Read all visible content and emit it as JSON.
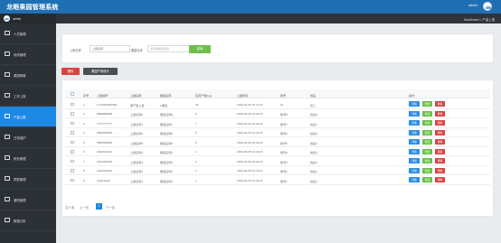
{
  "app": {
    "title": "龙眼果园管理系统",
    "user": "admin",
    "breadcrumb": "Dashboard > 产量上报"
  },
  "sidebar": {
    "profile_name": "admin",
    "items": [
      {
        "label": "人员管理",
        "icon": "users-icon",
        "active": false
      },
      {
        "label": "地块管理",
        "icon": "grid-icon",
        "active": false
      },
      {
        "label": "果园种植",
        "icon": "tree-icon",
        "active": false
      },
      {
        "label": "工作上报",
        "icon": "report-icon",
        "active": false
      },
      {
        "label": "产量上报",
        "icon": "list-icon",
        "active": true
      },
      {
        "label": "日常维护",
        "icon": "checklist-icon",
        "active": false
      },
      {
        "label": "财务管理",
        "icon": "chart-icon",
        "active": false
      },
      {
        "label": "预算管理",
        "icon": "user-icon",
        "active": false
      },
      {
        "label": "通知管理",
        "icon": "document-icon",
        "active": false
      },
      {
        "label": "数据分析",
        "icon": "analytics-icon",
        "active": false
      }
    ]
  },
  "search": {
    "label1": "上报名称",
    "input1_placeholder": "上报名称",
    "label2": "果园名称",
    "select2_placeholder": "请选择果园名称",
    "button": "查询"
  },
  "actions": {
    "delete": "删除",
    "stats": "果园产量统计"
  },
  "table": {
    "columns": [
      "序号",
      "上报编号",
      "上报名称",
      "果园名称",
      "实际产量(kg)",
      "上报时间",
      "账号",
      "姓名",
      "操作"
    ],
    "rows": [
      [
        "1",
        "1712381860959",
        "果产量上报",
        "A果园",
        "40",
        "2024-04-05 15:11:22",
        "11",
        "张三"
      ],
      [
        "2",
        "8888888888",
        "上报名称8",
        "果园名称8",
        "8",
        "2024-04-05 14:44:21",
        "账号8",
        "姓名8"
      ],
      [
        "3",
        "7777777777",
        "上报名称7",
        "果园名称7",
        "7",
        "2024-04-05 14:44:21",
        "账号7",
        "姓名7"
      ],
      [
        "4",
        "6666666666",
        "上报名称6",
        "果园名称6",
        "6",
        "2024-04-05 14:44:21",
        "账号6",
        "姓名6"
      ],
      [
        "5",
        "5555555555",
        "上报名称5",
        "果园名称5",
        "5",
        "2024-04-05 14:44:21",
        "账号5",
        "姓名5"
      ],
      [
        "6",
        "4444444444",
        "上报名称4",
        "果园名称4",
        "4",
        "2024-04-05 14:44:21",
        "账号4",
        "姓名4"
      ],
      [
        "7",
        "3333333333",
        "上报名称3",
        "果园名称3",
        "3",
        "2024-04-05 14:44:21",
        "账号3",
        "姓名3"
      ],
      [
        "8",
        "2222222222",
        "上报名称2",
        "果园名称2",
        "2",
        "2024-04-05 14:44:21",
        "账号2",
        "姓名2"
      ],
      [
        "9",
        "1111111111",
        "上报名称1",
        "果园名称1",
        "1",
        "2024-04-05 14:44:21",
        "账号1",
        "姓名1"
      ]
    ],
    "row_buttons": {
      "detail": "详情",
      "edit": "修改",
      "delete": "删除"
    }
  },
  "pagination": {
    "total": "共 9 条",
    "prev": "上一页",
    "current": "1",
    "next": "下一页"
  },
  "colors": {
    "topbar": "#1f6fb5",
    "sidebar": "#2c3136",
    "active": "#1e88e5",
    "green": "#6cc04a",
    "red": "#d94242"
  }
}
